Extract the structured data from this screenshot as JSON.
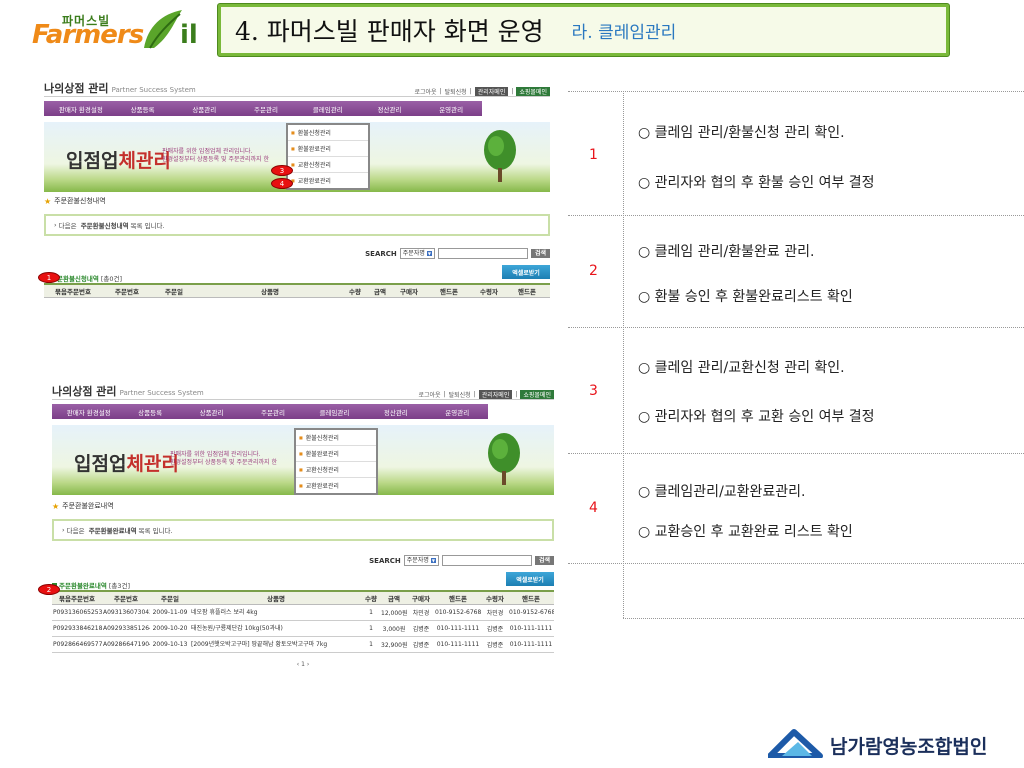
{
  "slide": {
    "logo_small": "파머스빌",
    "logo_big": "Farmers",
    "logo_end": "il",
    "title": "4. 파머스빌 판매자 화면 운영",
    "subtitle": "라. 클레임관리"
  },
  "shop": {
    "brand": "나의상점 관리",
    "brand_sub": "Partner Success System",
    "top_links": [
      "로그아웃",
      "탈퇴신청",
      "관리자메인",
      "쇼핑몰메인"
    ],
    "nav": [
      "판매자 환경설정",
      "상품등록",
      "상품관리",
      "주문관리",
      "클레임관리",
      "정산관리",
      "운영관리"
    ],
    "banner_title_a": "입점업",
    "banner_title_b": "체관리",
    "banner_sub1": "판매자를 위한 입점업체 관리입니다.",
    "banner_sub2": "환경설정부터 상품등록 및 주문관리까지 한",
    "dropdown": [
      "환불신청관리",
      "환불완료관리",
      "교환신청관리",
      "교환완료관리"
    ],
    "search_label": "SEARCH",
    "search_select": "주문자명",
    "search_btn": "검색",
    "excel_btn": "엑셀로받기",
    "columns": [
      "묶음주문번호",
      "주문번호",
      "주문일",
      "상품명",
      "수량",
      "금액",
      "구매자",
      "핸드폰",
      "수령자",
      "핸드폰"
    ]
  },
  "panel1": {
    "section_title": "주문환불신청내역",
    "notice_pre": "다음은",
    "notice_bold": "주문환불신청내역",
    "notice_post": "목록 입니다.",
    "list_title": "주문환불신청내역",
    "list_count": "[총0건]",
    "markers": [
      "3",
      "4",
      "1"
    ]
  },
  "panel2": {
    "section_title": "주문환불완료내역",
    "notice_pre": "다음은",
    "notice_bold": "주문환불완료내역",
    "notice_post": "목록 입니다.",
    "list_title": "주문환불완료내역",
    "list_count": "[총3건]",
    "marker": "2",
    "rows": [
      [
        "P093136065253",
        "A093136073043",
        "2009-11-09",
        "네오팜 휴플러스 보리 4kg",
        "1",
        "12,000원",
        "차민경",
        "010-9152-6768",
        "차민경",
        "010-9152-6768"
      ],
      [
        "P092933846218",
        "A092933851264",
        "2009-10-20",
        "태진농원/구룡제단감 10kg(50과내)",
        "1",
        "3,000원",
        "김병준",
        "010-111-1111",
        "김병준",
        "010-111-1111"
      ],
      [
        "P092866469577",
        "A092866471904",
        "2009-10-13",
        "[2009년햇오박고구마] 땅끝해남 황토오박고구마 7kg",
        "1",
        "32,900원",
        "김병준",
        "010-111-1111",
        "김병준",
        "010-111-1111"
      ]
    ],
    "pager": "‹ 1 ›"
  },
  "steps": [
    {
      "num": "1",
      "line1": "○ 클레임 관리/환불신청 관리  확인.",
      "line2": "○ 관리자와 협의 후 환불 승인 여부 결정"
    },
    {
      "num": "2",
      "line1": "○ 클레임 관리/환불완료 관리.",
      "line2": "○ 환불 승인 후 환불완료리스트 확인"
    },
    {
      "num": "3",
      "line1": "○ 클레임 관리/교환신청 관리  확인.",
      "line2": "○ 관리자와 협의 후 교환 승인 여부 결정"
    },
    {
      "num": "4",
      "line1": "○ 클레임관리/교환완료관리.",
      "line2": "○ 교환승인 후 교환완료 리스트 확인"
    }
  ],
  "footer": {
    "org": "남가람영농조합법인"
  },
  "colors": {
    "title_bar": "#7ab93a",
    "nav": "#8a4b96",
    "step_num": "#e8141b",
    "subtitle": "#2a78c0",
    "marker": "#e81010"
  }
}
